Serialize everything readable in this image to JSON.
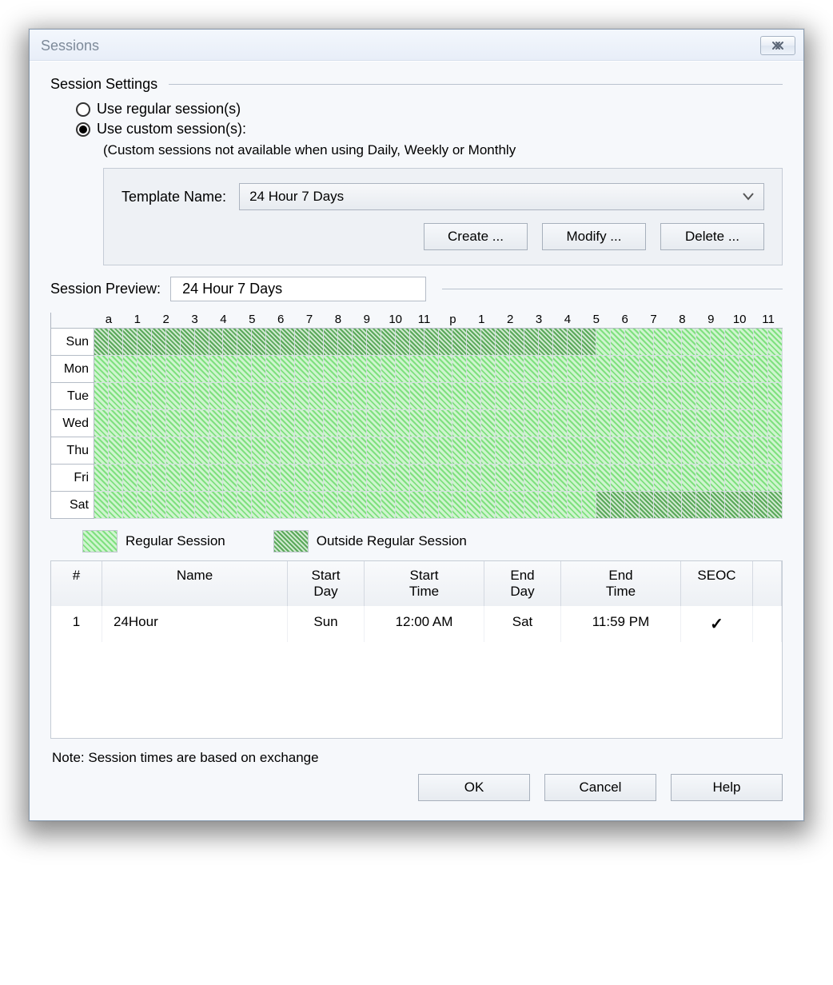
{
  "window": {
    "title": "Sessions"
  },
  "settings": {
    "group_title": "Session Settings",
    "radio_regular": "Use regular session(s)",
    "radio_custom": "Use custom session(s):",
    "selected": "custom",
    "hint": "(Custom sessions not available when using Daily, Weekly or Monthly",
    "template_label": "Template Name:",
    "template_value": "24 Hour 7 Days",
    "create_btn": "Create ...",
    "modify_btn": "Modify ...",
    "delete_btn": "Delete ..."
  },
  "preview": {
    "label": "Session Preview:",
    "value": "24 Hour 7 Days",
    "hour_headers": [
      "a",
      "1",
      "2",
      "3",
      "4",
      "5",
      "6",
      "7",
      "8",
      "9",
      "10",
      "11",
      "p",
      "1",
      "2",
      "3",
      "4",
      "5",
      "6",
      "7",
      "8",
      "9",
      "10",
      "11"
    ],
    "days": [
      "Sun",
      "Mon",
      "Tue",
      "Wed",
      "Thu",
      "Fri",
      "Sat"
    ],
    "outside_ranges": [
      {
        "day": 0,
        "from_half": 0,
        "to_half": 35
      },
      {
        "day": 6,
        "from_half": 35,
        "to_half": 48
      }
    ]
  },
  "legend": {
    "regular": "Regular Session",
    "outside": "Outside Regular Session"
  },
  "table": {
    "headers": {
      "n": "#",
      "name": "Name",
      "sd": "Start\nDay",
      "st": "Start\nTime",
      "ed": "End\nDay",
      "et": "End\nTime",
      "seoc": "SEOC"
    },
    "rows": [
      {
        "n": "1",
        "name": "24Hour",
        "sd": "Sun",
        "st": "12:00 AM",
        "ed": "Sat",
        "et": "11:59 PM",
        "seoc": true
      }
    ]
  },
  "note": "Note: Session times are based on exchange",
  "footer": {
    "ok": "OK",
    "cancel": "Cancel",
    "help": "Help"
  }
}
